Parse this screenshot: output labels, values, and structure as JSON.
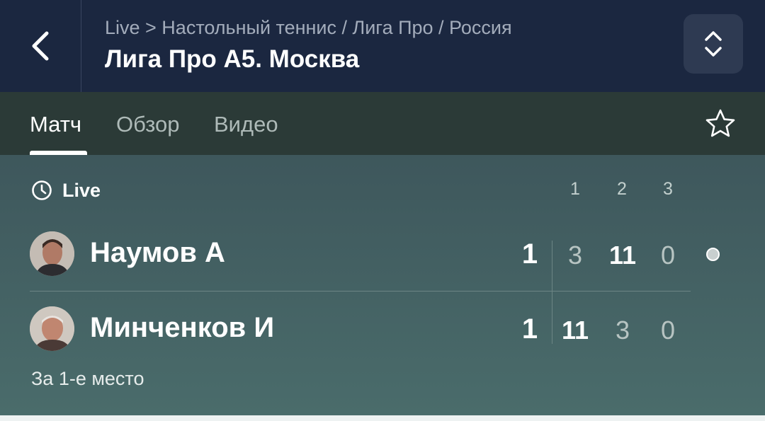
{
  "header": {
    "breadcrumb": "Live > Настольный теннис / Лига Про / Россия",
    "title": "Лига Про А5. Москва"
  },
  "tabs": [
    {
      "label": "Матч",
      "active": true
    },
    {
      "label": "Обзор",
      "active": false
    },
    {
      "label": "Видео",
      "active": false
    }
  ],
  "match": {
    "status": "Live",
    "set_headers": [
      "1",
      "2",
      "3"
    ],
    "players": [
      {
        "name": "Наумов А",
        "total": "1",
        "sets": [
          "3",
          "11",
          "0"
        ],
        "serving": true
      },
      {
        "name": "Минченков И",
        "total": "1",
        "sets": [
          "11",
          "3",
          "0"
        ],
        "serving": false
      }
    ],
    "note": "За 1-е место"
  },
  "icons": {
    "back": "chevron-left-icon",
    "switch": "chevron-up-down-icon",
    "favorite": "star-outline-icon",
    "status": "clock-icon"
  },
  "colors": {
    "header_bg": "#1b2740",
    "tabs_bg": "#2b3a37",
    "match_bg": "#44625f"
  }
}
